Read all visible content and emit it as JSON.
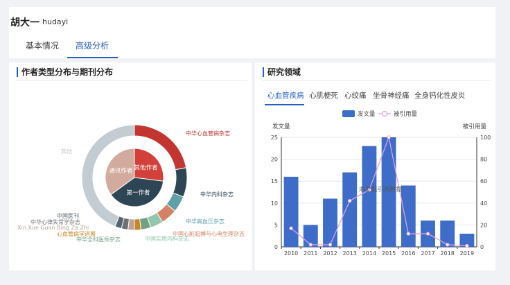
{
  "header": {
    "name": "胡大一",
    "pinyin": "hudayi"
  },
  "tabs": [
    {
      "label": "基本情况",
      "active": false
    },
    {
      "label": "高级分析",
      "active": true
    }
  ],
  "left_panel": {
    "title": "作者类型分布与期刊分布"
  },
  "right_panel": {
    "title": "研究领域",
    "subtabs": [
      "心血管疾病",
      "心肌梗死",
      "心绞痛",
      "坐骨神经痛",
      "全身钙化性皮炎"
    ],
    "active_subtab": "心血管疾病"
  },
  "chart_data": [
    {
      "type": "pie",
      "inner_ring": {
        "labels": [
          "其他作者",
          "第一作者",
          "通讯作者"
        ],
        "values": [
          27,
          38,
          35
        ],
        "colors": [
          "#d2403a",
          "#2e4556",
          "#d3aa9e"
        ]
      },
      "outer_ring": {
        "labels": [
          "中华心血管病杂志",
          "中华内科杂志",
          "中华高血压杂志",
          "中国心脏起搏与心电生理杂志",
          "中国实用内科杂志",
          "中华全科医师杂志",
          "心血管病学进展",
          "Xin Xue Guan Bing Za Zhi",
          "中华心律失常学杂志",
          "中国医刊",
          "其他"
        ],
        "values": [
          22,
          9,
          5,
          5,
          4,
          3,
          2,
          2,
          2,
          2,
          44
        ],
        "colors": [
          "#c23531",
          "#2f4554",
          "#61a0a8",
          "#d48265",
          "#91c7ae",
          "#749f83",
          "#ca8622",
          "#bda29a",
          "#6e7074",
          "#546570",
          "#c4ccd3"
        ]
      }
    },
    {
      "type": "bar",
      "legend": [
        "发文量",
        "被引用量"
      ],
      "ylabel": "发文量",
      "y2label": "被引用量",
      "categories": [
        "2010",
        "2011",
        "2012",
        "2013",
        "2014",
        "2015",
        "2016",
        "2017",
        "2018",
        "2019"
      ],
      "ylim": [
        0,
        25
      ],
      "y2lim": [
        0,
        100
      ],
      "y_ticks": [
        "0",
        "5",
        "10",
        "15",
        "20",
        "25"
      ],
      "y2_ticks": [
        "0",
        "20",
        "40",
        "60",
        "80",
        "100"
      ],
      "series": [
        {
          "name": "发文量",
          "type": "bar",
          "color": "#3d6dc8",
          "values": [
            16,
            5,
            11,
            17,
            23,
            25,
            14,
            6,
            6,
            3
          ]
        },
        {
          "name": "被引用量",
          "type": "line",
          "axis": "right",
          "color": "#e0a0e0",
          "values": [
            17,
            2,
            2,
            42,
            52,
            100,
            12,
            12,
            2,
            1
          ]
        }
      ],
      "overlay_text": "未发现引用数据"
    }
  ]
}
